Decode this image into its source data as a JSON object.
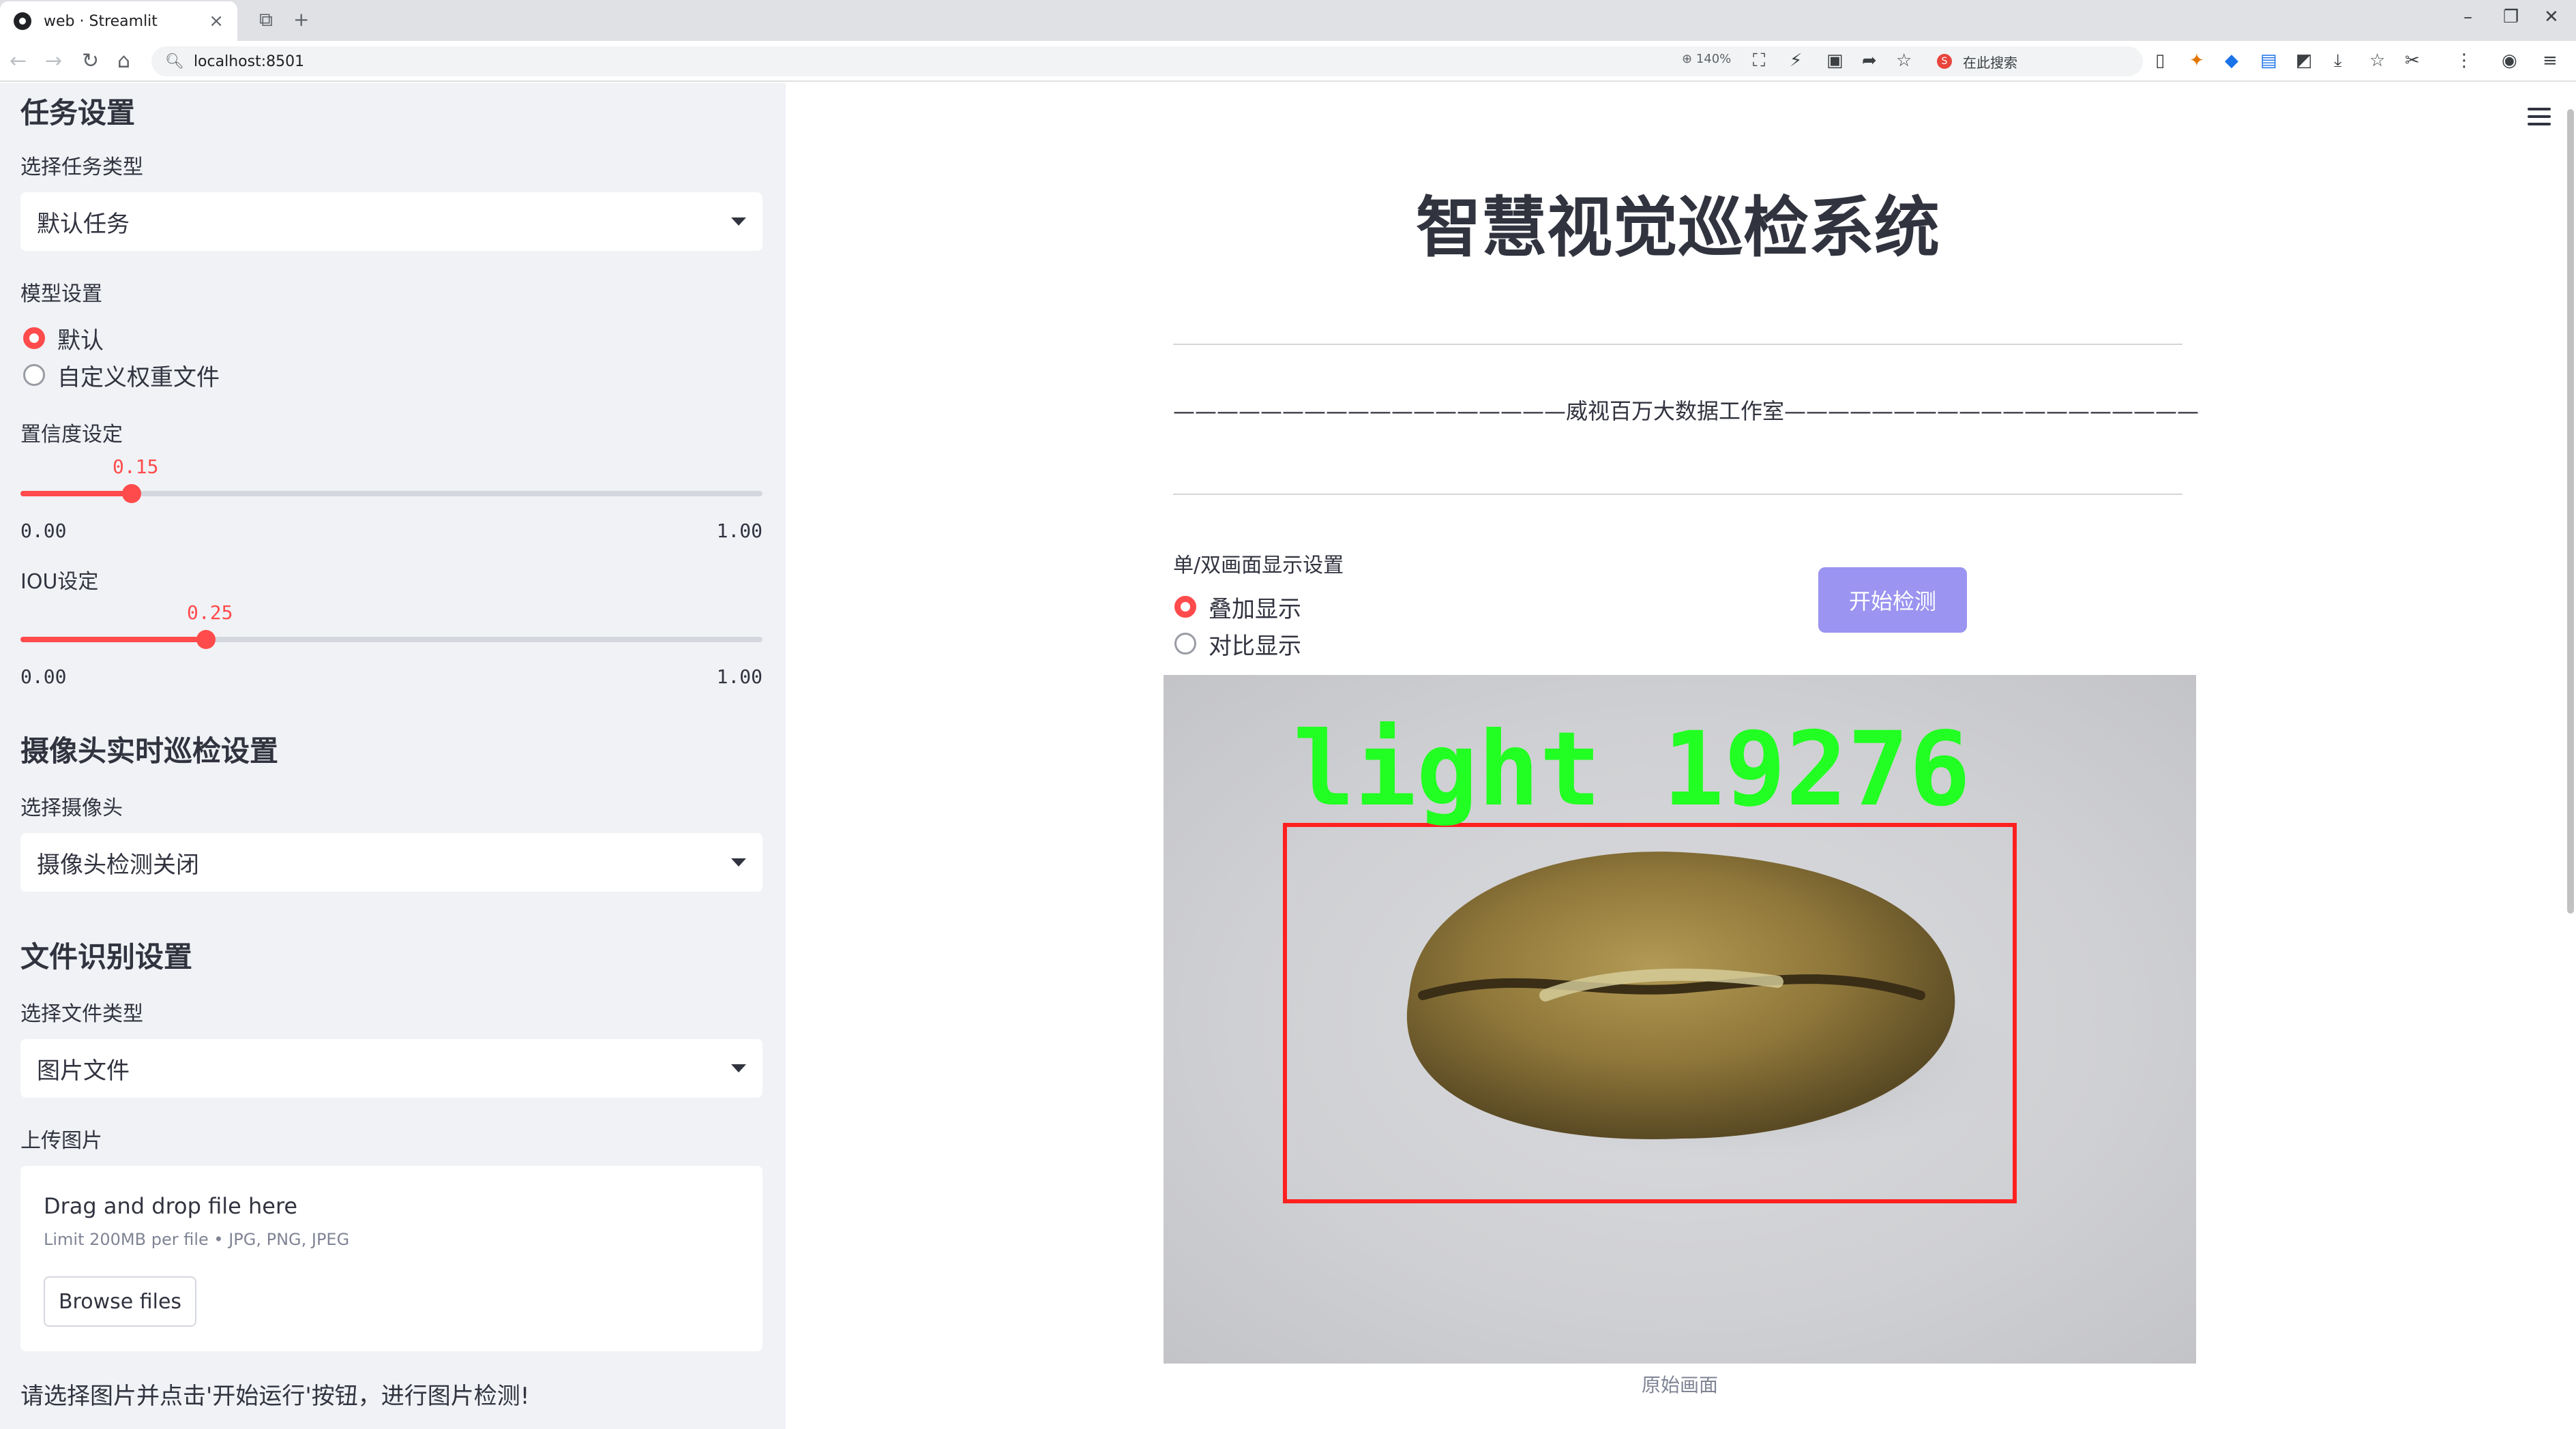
{
  "browser": {
    "tab_title": "web · Streamlit",
    "url": "localhost:8501",
    "zoom": "140%",
    "search_placeholder": "在此搜索"
  },
  "sidebar": {
    "task_section_title": "任务设置",
    "task_type_label": "选择任务类型",
    "task_type_value": "默认任务",
    "model_label": "模型设置",
    "model_options": [
      "默认",
      "自定义权重文件"
    ],
    "model_selected": "默认",
    "confidence_label": "置信度设定",
    "confidence": {
      "value": "0.15",
      "min": "0.00",
      "max": "1.00",
      "fraction": 0.15
    },
    "iou_label": "IOU设定",
    "iou": {
      "value": "0.25",
      "min": "0.00",
      "max": "1.00",
      "fraction": 0.25
    },
    "camera_section_title": "摄像头实时巡检设置",
    "camera_label": "选择摄像头",
    "camera_value": "摄像头检测关闭",
    "file_section_title": "文件识别设置",
    "file_type_label": "选择文件类型",
    "file_type_value": "图片文件",
    "upload_label": "上传图片",
    "upload": {
      "drag_text": "Drag and drop file here",
      "limit_text": "Limit 200MB per file • JPG, PNG, JPEG",
      "browse_label": "Browse files"
    },
    "note": "请选择图片并点击'开始运行'按钮，进行图片检测!"
  },
  "main": {
    "title": "智慧视觉巡检系统",
    "subtitle": "——————————————————威视百万大数据工作室———————————————————",
    "display_label": "单/双画面显示设置",
    "display_options": [
      "叠加显示",
      "对比显示"
    ],
    "display_selected": "叠加显示",
    "start_button": "开始检测",
    "detection_label": "light 19276",
    "image_caption": "原始画面"
  },
  "colors": {
    "accent": "#ff4b4b",
    "button": "#9b94f0",
    "detection_box": "#ff2020",
    "detection_text": "#22ff22"
  }
}
